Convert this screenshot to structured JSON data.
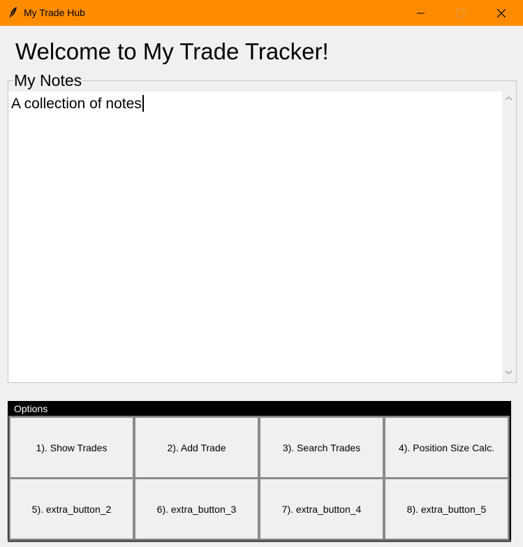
{
  "window": {
    "title": "My Trade Hub",
    "minimize_glyph": "—",
    "maximize_glyph": "☐",
    "close_glyph": "✕"
  },
  "main": {
    "heading": "Welcome to My Trade Tracker!"
  },
  "notes": {
    "legend": "My Notes",
    "text": "A collection of notes"
  },
  "options": {
    "legend": "Options",
    "buttons": [
      "1). Show Trades",
      "2). Add Trade",
      "3). Search Trades",
      "4). Position Size Calc.",
      "5). extra_button_2",
      "6). extra_button_3",
      "7). extra_button_4",
      "8). extra_button_5"
    ]
  }
}
